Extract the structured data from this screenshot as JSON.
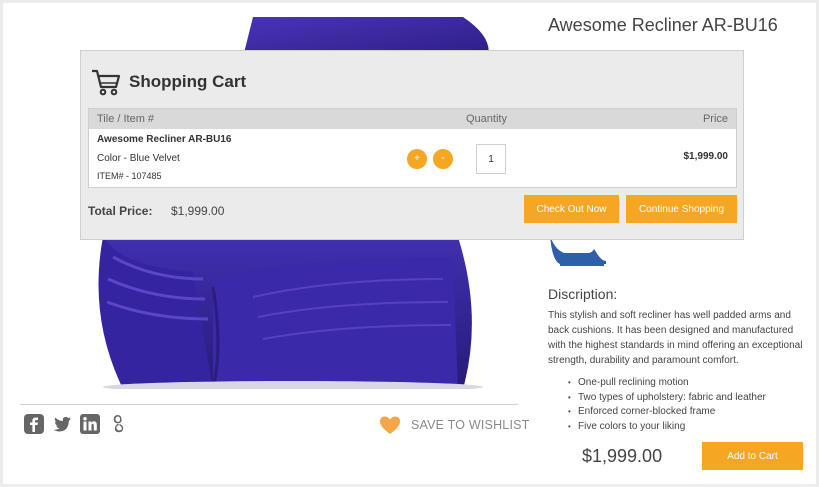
{
  "product": {
    "title": "Awesome Recliner AR-BU16",
    "description_heading": "Discription:",
    "description": "This stylish and soft recliner has well padded arms and back cushions. It has been designed and manufactured with the highest standards in mind offering an exceptional strength, durability and paramount comfort.",
    "features": [
      "One-pull reclining motion",
      "Two types of upholstery: fabric and leather",
      "Enforced corner-blocked frame",
      "Five colors to your liking"
    ],
    "price": "$1,999.00",
    "add_to_cart_label": "Add to Cart",
    "chair_color": "#3f2aa8"
  },
  "share": {
    "icons": [
      "facebook-icon",
      "twitter-icon",
      "linkedin-icon",
      "google-icon"
    ],
    "wishlist_label": "SAVE TO WISHLIST"
  },
  "cart": {
    "title": "Shopping Cart",
    "columns": {
      "item": "Tile / Item #",
      "quantity": "Quantity",
      "price": "Price"
    },
    "items": [
      {
        "name": "Awesome Recliner AR-BU16",
        "color": "Color - Blue Velvet",
        "item_number": "ITEM# - 107485",
        "quantity": "1",
        "price": "$1,999.00",
        "plus_label": "+",
        "minus_label": "-"
      }
    ],
    "total_label": "Total Price:",
    "total_value": "$1,999.00",
    "checkout_label": "Check Out Now",
    "continue_label": "Continue Shopping"
  },
  "colors": {
    "accent": "#f5a623",
    "recliner_icon": "#2f5fa8"
  }
}
